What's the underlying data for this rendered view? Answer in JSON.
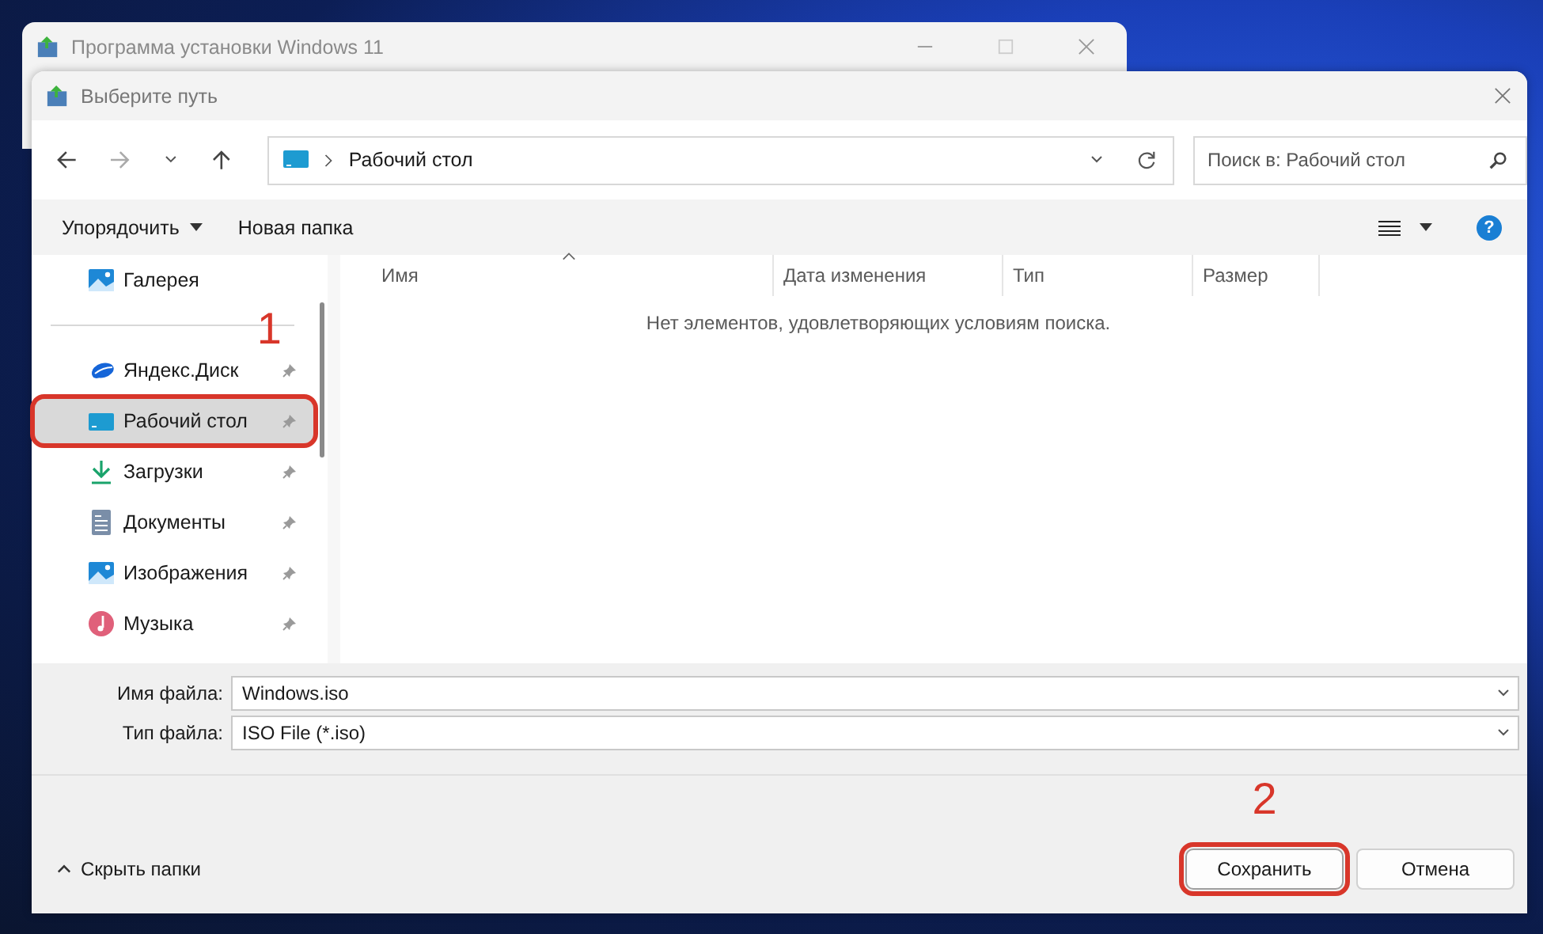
{
  "parent_window": {
    "title": "Программа установки Windows 11"
  },
  "dialog": {
    "title": "Выберите путь"
  },
  "address_bar": {
    "path": "Рабочий стол"
  },
  "search": {
    "placeholder": "Поиск в: Рабочий стол"
  },
  "command_bar": {
    "organize": "Упорядочить",
    "new_folder": "Новая папка",
    "help": "?"
  },
  "sidebar": {
    "sections": [
      {
        "items": [
          {
            "label": "Галерея",
            "kind": "gallery",
            "pinned": false,
            "selected": false,
            "highlighted": false
          }
        ]
      },
      {
        "items": [
          {
            "label": "Яндекс.Диск",
            "kind": "cloud",
            "pinned": true,
            "selected": false,
            "highlighted": false
          },
          {
            "label": "Рабочий стол",
            "kind": "desktop",
            "pinned": true,
            "selected": true,
            "highlighted": true,
            "callout": "1"
          },
          {
            "label": "Загрузки",
            "kind": "download",
            "pinned": true,
            "selected": false,
            "highlighted": false
          },
          {
            "label": "Документы",
            "kind": "documents",
            "pinned": true,
            "selected": false,
            "highlighted": false
          },
          {
            "label": "Изображения",
            "kind": "pictures",
            "pinned": true,
            "selected": false,
            "highlighted": false
          },
          {
            "label": "Музыка",
            "kind": "music",
            "pinned": true,
            "selected": false,
            "highlighted": false
          }
        ]
      }
    ]
  },
  "table": {
    "columns": [
      {
        "label": "Имя",
        "sorted": true
      },
      {
        "label": "Дата изменения",
        "sorted": false
      },
      {
        "label": "Тип",
        "sorted": false
      },
      {
        "label": "Размер",
        "sorted": false
      }
    ],
    "empty_message": "Нет элементов, удовлетворяющих условиям поиска."
  },
  "fields": [
    {
      "label": "Имя файла:",
      "value": "Windows.iso"
    },
    {
      "label": "Тип файла:",
      "value": "ISO File (*.iso)"
    }
  ],
  "footer": {
    "hide_folders": "Скрыть папки",
    "buttons": [
      {
        "label": "Сохранить",
        "highlighted": true,
        "callout": "2"
      },
      {
        "label": "Отмена",
        "highlighted": false
      }
    ]
  }
}
